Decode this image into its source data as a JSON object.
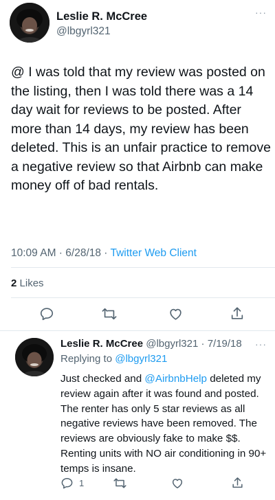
{
  "main_tweet": {
    "author_name": "Leslie R. McCree",
    "author_handle": "@lbgyrl321",
    "more": "···",
    "text": "@ I was told that my review was posted on the listing, then I was told there was a 14 day wait for reviews to be posted. After more than 14 days, my review has been deleted. This is an unfair practice to remove a negative review so that Airbnb can make money off of bad rentals.",
    "time": "10:09 AM",
    "date": "6/28/18",
    "separator": " · ",
    "client": "Twitter Web Client",
    "likes_count": "2",
    "likes_label": "Likes"
  },
  "reply_tweet": {
    "author_name": "Leslie R. McCree",
    "author_handle": "@lbgyrl321",
    "date": "7/19/18",
    "separator": " · ",
    "more": "···",
    "replying_label": "Replying to",
    "replying_to": "@lbgyrl321",
    "text_before": "Just checked and ",
    "mention": "@AirbnbHelp",
    "text_after": " deleted my review again after it was found and posted. The renter has only 5 star reviews as all negative reviews have been removed. The reviews are obviously fake to make $$. Renting units with NO air conditioning in 90+ temps is insane.",
    "reply_count": "1"
  },
  "colors": {
    "text": "#0f1419",
    "secondary": "#536471",
    "accent": "#1d9bf0",
    "divider": "#e1e8ed"
  },
  "icons": [
    "reply-icon",
    "retweet-icon",
    "like-icon",
    "share-icon",
    "more-icon",
    "avatar"
  ]
}
